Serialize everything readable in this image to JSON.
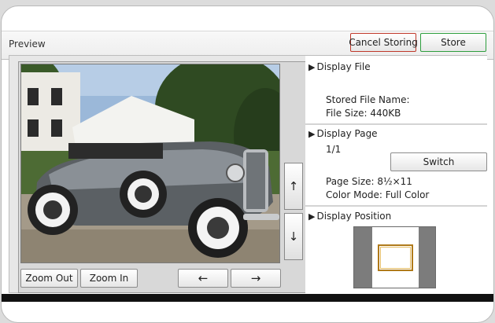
{
  "header": {
    "title": "Preview",
    "cancel_label": "Cancel Storing",
    "store_label": "Store"
  },
  "preview": {
    "zoom_out_label": "Zoom Out",
    "zoom_in_label": "Zoom In",
    "scroll_up_icon": "↑",
    "scroll_down_icon": "↓",
    "nav_left_icon": "←",
    "nav_right_icon": "→"
  },
  "display_file": {
    "title": "Display File",
    "stored_name_label": "Stored File Name:",
    "file_size": "File Size: 440KB"
  },
  "display_page": {
    "title": "Display Page",
    "page_counter": "1/1",
    "switch_label": "Switch",
    "page_size": "Page Size: 8½×11",
    "color_mode": "Color Mode: Full Color"
  },
  "display_position": {
    "title": "Display Position"
  },
  "colors": {
    "cancel_border": "#c0392b",
    "store_border": "#2e9e3e",
    "position_frame": "#b07a1a"
  }
}
